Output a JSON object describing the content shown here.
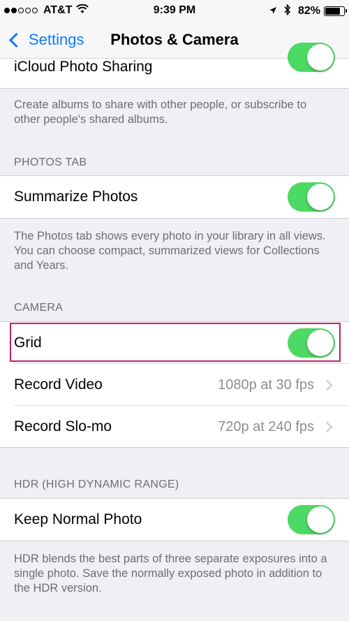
{
  "status_bar": {
    "carrier": "AT&T",
    "time": "9:39 PM",
    "battery_percent": "82%",
    "battery_level": 0.82,
    "signal_bars_filled": 2,
    "signal_bars_total": 5
  },
  "nav": {
    "back_label": "Settings",
    "title": "Photos & Camera"
  },
  "icloud": {
    "label": "iCloud Photo Sharing",
    "enabled": true,
    "footer": "Create albums to share with other people, or subscribe to other people's shared albums."
  },
  "photos_tab": {
    "header": "PHOTOS TAB",
    "summarize_label": "Summarize Photos",
    "summarize_enabled": true,
    "footer": "The Photos tab shows every photo in your library in all views. You can choose compact, summarized views for Collections and Years."
  },
  "camera": {
    "header": "CAMERA",
    "grid_label": "Grid",
    "grid_enabled": true,
    "record_video_label": "Record Video",
    "record_video_value": "1080p at 30 fps",
    "record_slomo_label": "Record Slo-mo",
    "record_slomo_value": "720p at 240 fps"
  },
  "hdr": {
    "header": "HDR (HIGH DYNAMIC RANGE)",
    "keep_normal_label": "Keep Normal Photo",
    "keep_normal_enabled": true,
    "footer": "HDR blends the best parts of three separate exposures into a single photo. Save the normally exposed photo in addition to the HDR version."
  },
  "colors": {
    "accent": "#0f7afe",
    "toggle_on": "#4cd964",
    "highlight": "#c51f66",
    "background": "#efeff4"
  }
}
